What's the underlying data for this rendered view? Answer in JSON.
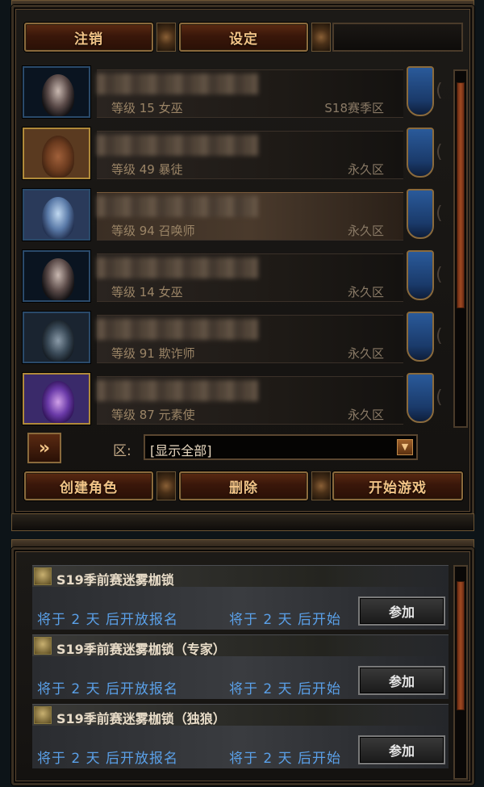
{
  "top_buttons": {
    "logout": "注销",
    "settings": "设定"
  },
  "characters": [
    {
      "level": "等级 15 女巫",
      "zone": "S18赛季区",
      "portrait": "witch",
      "frame": "blue"
    },
    {
      "level": "等级 49 暴徒",
      "zone": "永久区",
      "portrait": "marauder",
      "frame": "gold"
    },
    {
      "level": "等级 94 召唤师",
      "zone": "永久区",
      "portrait": "summoner",
      "frame": "blue",
      "selected": true
    },
    {
      "level": "等级 14 女巫",
      "zone": "永久区",
      "portrait": "witch",
      "frame": "blue"
    },
    {
      "level": "等级 91 欺诈师",
      "zone": "永久区",
      "portrait": "trickster",
      "frame": "blue"
    },
    {
      "level": "等级 87 元素使",
      "zone": "永久区",
      "portrait": "elementalist",
      "frame": "gold"
    }
  ],
  "filter": {
    "label": "区:",
    "selected": "[显示全部]"
  },
  "bottom_buttons": {
    "create": "创建角色",
    "delete": "删除",
    "start": "开始游戏"
  },
  "events": [
    {
      "title": "S19季前赛迷雾枷锁",
      "registration": "将于 2 天 后开放报名",
      "start": "将于 2 天 后开始",
      "join": "参加"
    },
    {
      "title": "S19季前赛迷雾枷锁（专家）",
      "registration": "将于 2 天 后开放报名",
      "start": "将于 2 天 后开始",
      "join": "参加"
    },
    {
      "title": "S19季前赛迷雾枷锁（独狼）",
      "registration": "将于 2 天 后开放报名",
      "start": "将于 2 天 后开始",
      "join": "参加"
    }
  ],
  "colors": {
    "button_text": "#f2c487",
    "event_text": "#5aa0e8",
    "frame": "#8a6a3c"
  }
}
